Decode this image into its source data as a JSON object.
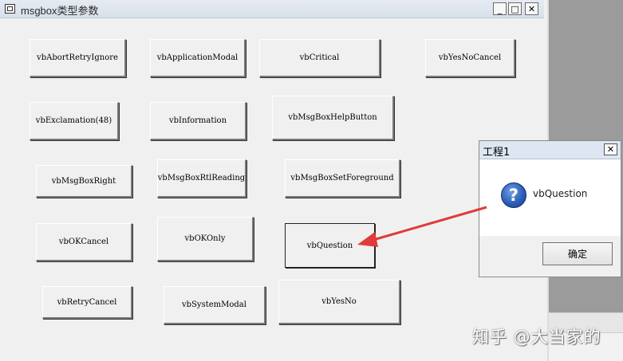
{
  "window": {
    "title": "msgbox类型参数",
    "controls": {
      "minimize": "_",
      "maximize": "□",
      "close": "✕"
    }
  },
  "buttons": {
    "abort_retry_ignore": "vbAbortRetryIgnore",
    "application_modal": "vbApplicationModal",
    "critical": "vbCritical",
    "yes_no_cancel": "vbYesNoCancel",
    "exclamation": "vbExclamation(48)",
    "information": "vbInformation",
    "help_button": "vbMsgBoxHelpButton",
    "msgbox_right": "vbMsgBoxRight",
    "rtl_reading": "vbMsgBoxRtlReading",
    "set_foreground": "vbMsgBoxSetForeground",
    "ok_cancel": "vbOKCancel",
    "ok_only": "vbOKOnly",
    "question": "vbQuestion",
    "retry_cancel": "vbRetryCancel",
    "system_modal": "vbSystemModal",
    "yes_no": "vbYesNo"
  },
  "dialog": {
    "title": "工程1",
    "close": "✕",
    "icon": "question-icon",
    "icon_glyph": "?",
    "message": "vbQuestion",
    "ok_label": "确定"
  },
  "watermark": "知乎 @大当家的",
  "colors": {
    "arrow": "#e03b3b",
    "dialog_titlebar": "#dde6f1",
    "question_icon": "#2c5fb8"
  }
}
